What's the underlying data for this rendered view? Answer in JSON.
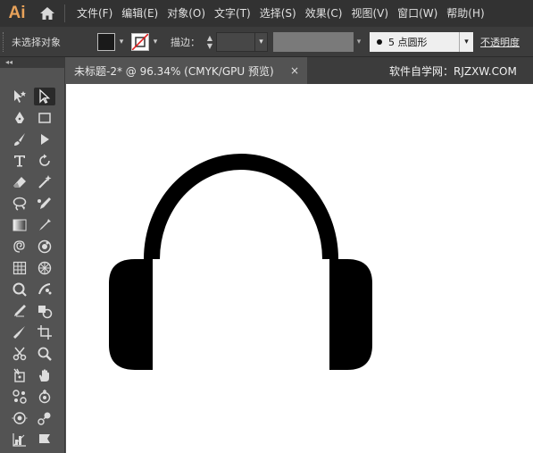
{
  "app": {
    "logo": "Ai"
  },
  "menu": {
    "items": [
      {
        "label": "文件(F)"
      },
      {
        "label": "编辑(E)"
      },
      {
        "label": "对象(O)"
      },
      {
        "label": "文字(T)"
      },
      {
        "label": "选择(S)"
      },
      {
        "label": "效果(C)"
      },
      {
        "label": "视图(V)"
      },
      {
        "label": "窗口(W)"
      },
      {
        "label": "帮助(H)"
      }
    ]
  },
  "control_bar": {
    "selection_status": "未选择对象",
    "fill_color": "#1a1a1a",
    "stroke_color": "none",
    "stroke_label": "描边：",
    "brush_value": "5 点圆形",
    "opacity_label": "不透明度"
  },
  "document": {
    "tab_title": "未标题-2* @ 96.34% (CMYK/GPU 预览)",
    "close_glyph": "×",
    "watermark": "软件自学网：RJZXW.COM"
  },
  "toolbar": {
    "collapse_glyph": "◂◂",
    "tools": [
      "magic-selection-icon",
      "direct-selection-icon",
      "pen-icon",
      "rectangle-icon",
      "brush-icon",
      "shaper-icon",
      "type-icon",
      "rotate-icon",
      "eraser-icon",
      "magic-wand-icon",
      "lasso-icon",
      "anchor-pen-icon",
      "gradient-icon",
      "eyedropper-icon",
      "spiral-icon",
      "blob-icon",
      "mesh-icon",
      "perspective-icon",
      "warp-icon",
      "symbol-sprayer-icon",
      "pencil-icon",
      "shape-builder-icon",
      "knife-icon",
      "artboard-icon",
      "scissors-icon",
      "zoom-icon",
      "slice-icon",
      "hand-icon",
      "puppet-warp-icon",
      "live-paint-icon",
      "eyeglass-icon",
      "flare-icon",
      "column-graph-icon",
      "flag-icon"
    ]
  }
}
